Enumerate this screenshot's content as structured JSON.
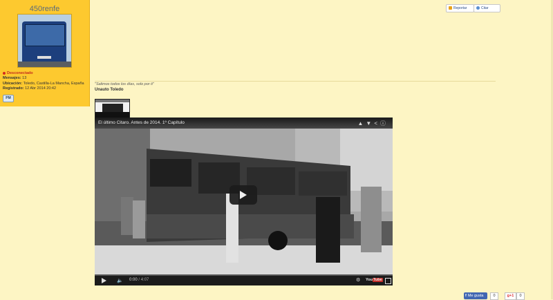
{
  "user": {
    "name": "450renfe",
    "status": "Desconectado",
    "messages_label": "Mensajes:",
    "messages_value": "13",
    "location_label": "Ubicación:",
    "location_value": "Toledo, Castilla-La Mancha, España",
    "registered_label": "Registrado:",
    "registered_value": "12 Abr 2014 20:42",
    "pm_label": "PM"
  },
  "post_actions": {
    "report_label": "Reportar",
    "quote_label": "Citar"
  },
  "signature": {
    "quote": "\"Salimos todos los días, solo por ti\"",
    "name": "Unauto Toledo"
  },
  "video": {
    "title": "El último Citaro. Antes de 2014. 1º Capítulo",
    "current_time": "0:00",
    "duration": "/ 4:07",
    "youtube_label": "You",
    "youtube_tube": "Tube"
  },
  "social": {
    "fb_label": "Me gusta",
    "fb_count": "0",
    "gplus_label": "g+1",
    "gplus_count": "0"
  }
}
